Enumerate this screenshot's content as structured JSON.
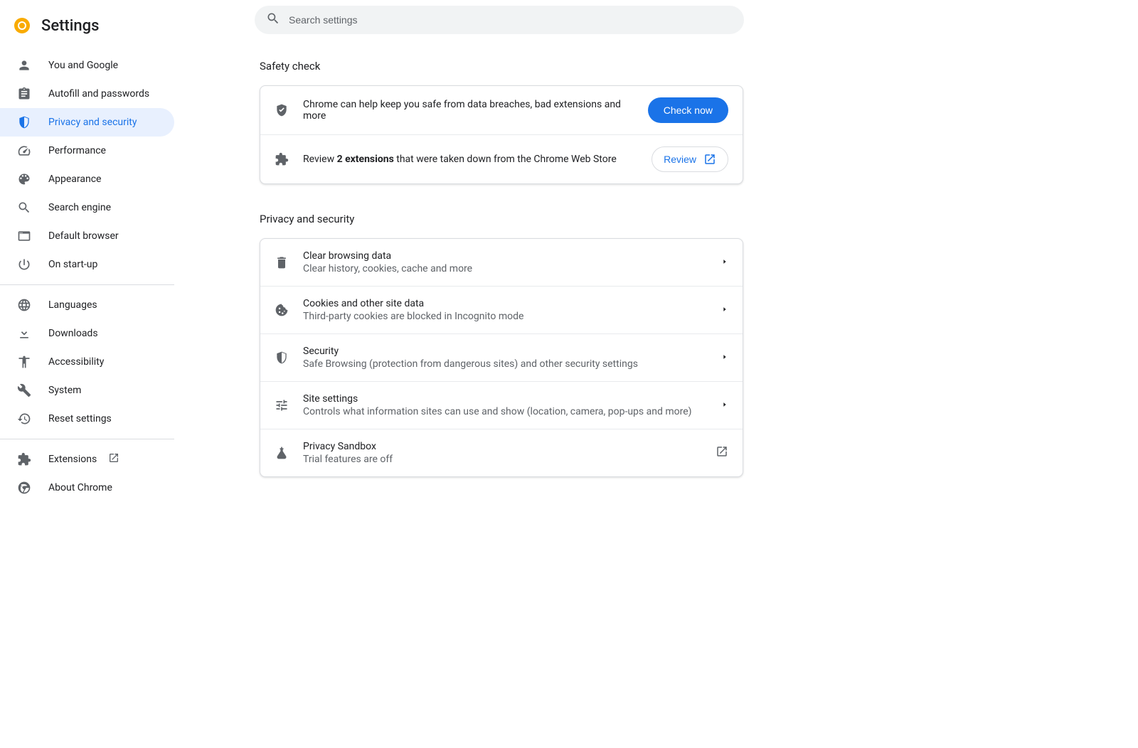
{
  "app_title": "Settings",
  "search": {
    "placeholder": "Search settings"
  },
  "sidebar": {
    "groups": [
      {
        "items": [
          {
            "id": "you-and-google",
            "icon": "person-icon",
            "label": "You and Google"
          },
          {
            "id": "autofill",
            "icon": "clipboard-icon",
            "label": "Autofill and passwords"
          },
          {
            "id": "privacy",
            "icon": "shield-icon",
            "label": "Privacy and security",
            "active": true
          },
          {
            "id": "performance",
            "icon": "speedometer-icon",
            "label": "Performance"
          },
          {
            "id": "appearance",
            "icon": "palette-icon",
            "label": "Appearance"
          },
          {
            "id": "search-engine",
            "icon": "search-icon",
            "label": "Search engine"
          },
          {
            "id": "default-browser",
            "icon": "browser-icon",
            "label": "Default browser"
          },
          {
            "id": "on-startup",
            "icon": "power-icon",
            "label": "On start-up"
          }
        ]
      },
      {
        "items": [
          {
            "id": "languages",
            "icon": "globe-icon",
            "label": "Languages"
          },
          {
            "id": "downloads",
            "icon": "download-icon",
            "label": "Downloads"
          },
          {
            "id": "accessibility",
            "icon": "accessibility-icon",
            "label": "Accessibility"
          },
          {
            "id": "system",
            "icon": "wrench-icon",
            "label": "System"
          },
          {
            "id": "reset",
            "icon": "restore-icon",
            "label": "Reset settings"
          }
        ]
      },
      {
        "items": [
          {
            "id": "extensions",
            "icon": "extension-icon",
            "label": "Extensions",
            "external": true
          },
          {
            "id": "about",
            "icon": "chrome-icon",
            "label": "About Chrome"
          }
        ]
      }
    ]
  },
  "safety_check": {
    "title": "Safety check",
    "row1_text": "Chrome can help keep you safe from data breaches, bad extensions and more",
    "row1_button": "Check now",
    "row2_prefix": "Review ",
    "row2_bold": "2 extensions",
    "row2_suffix": " that were taken down from the Chrome Web Store",
    "row2_button": "Review"
  },
  "privacy_section": {
    "title": "Privacy and security",
    "rows": [
      {
        "id": "clear-browsing",
        "icon": "trash-icon",
        "title": "Clear browsing data",
        "sub": "Clear history, cookies, cache and more",
        "trailing": "arrow"
      },
      {
        "id": "cookies",
        "icon": "cookie-icon",
        "title": "Cookies and other site data",
        "sub": "Third-party cookies are blocked in Incognito mode",
        "trailing": "arrow"
      },
      {
        "id": "security",
        "icon": "shield-security-icon",
        "title": "Security",
        "sub": "Safe Browsing (protection from dangerous sites) and other security settings",
        "trailing": "arrow"
      },
      {
        "id": "site-settings",
        "icon": "tune-icon",
        "title": "Site settings",
        "sub": "Controls what information sites can use and show (location, camera, pop-ups and more)",
        "trailing": "arrow"
      },
      {
        "id": "privacy-sandbox",
        "icon": "flask-icon",
        "title": "Privacy Sandbox",
        "sub": "Trial features are off",
        "trailing": "external"
      }
    ]
  },
  "colors": {
    "accent": "#1a73e8",
    "active_bg": "#e8f0fe",
    "text_secondary": "#5f6368"
  }
}
